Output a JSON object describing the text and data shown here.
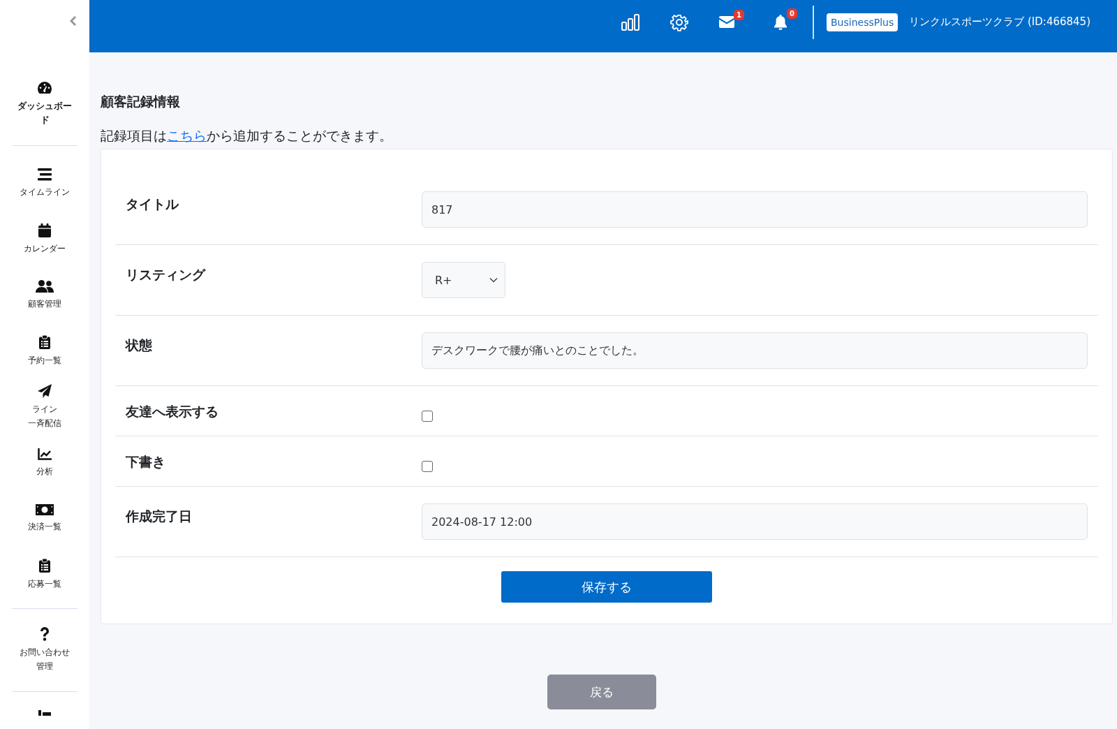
{
  "sidebar": {
    "items": [
      {
        "label_lines": [
          "ダッシュボード"
        ],
        "selected": true
      },
      {
        "label_lines": [
          "タイムライン"
        ],
        "selected": false
      },
      {
        "label_lines": [
          "カレンダー"
        ],
        "selected": false
      },
      {
        "label_lines": [
          "顧客管理"
        ],
        "selected": false
      },
      {
        "label_lines": [
          "予約一覧"
        ],
        "selected": false
      },
      {
        "label_lines": [
          "ライン",
          "一斉配信"
        ],
        "selected": false
      },
      {
        "label_lines": [
          "分析"
        ],
        "selected": false
      },
      {
        "label_lines": [
          "決済一覧"
        ],
        "selected": false
      },
      {
        "label_lines": [
          "応募一覧"
        ],
        "selected": false
      },
      {
        "label_lines": [
          "お問い合わせ",
          "管理"
        ],
        "selected": false
      }
    ]
  },
  "header": {
    "mail_count": "1",
    "notification_count": "0",
    "plan": "BusinessPlus",
    "account": "リンクルスポーツクラブ (ID:466845)"
  },
  "page": {
    "title": "顧客記録情報",
    "intro": {
      "before": "記録項目は",
      "link": "こちら",
      "after": "から追加することができます。"
    }
  },
  "form": {
    "fields": [
      {
        "kind": "text",
        "label": "タイトル",
        "value": "817"
      },
      {
        "kind": "select",
        "label": "リスティング",
        "value": "R+"
      },
      {
        "kind": "text",
        "label": "状態",
        "value": "デスクワークで腰が痛いとのことでした。"
      },
      {
        "kind": "checkbox",
        "label": "友達へ表示する",
        "checked": false
      },
      {
        "kind": "checkbox",
        "label": "下書き",
        "checked": false
      },
      {
        "kind": "text",
        "label": "作成完了日",
        "value": "2024-08-17 12:00"
      }
    ],
    "submit": "保存する"
  },
  "back": "戻る"
}
